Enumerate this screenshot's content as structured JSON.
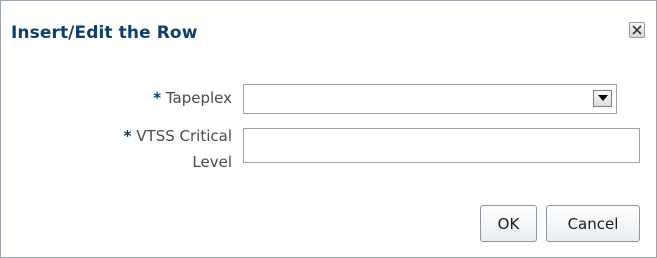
{
  "dialog": {
    "title": "Insert/Edit the Row",
    "close_icon": "close-icon"
  },
  "form": {
    "required_mark": "*",
    "tapeplex_label": "Tapeplex",
    "tapeplex_value": "",
    "dropdown_icon": "chevron-down-icon",
    "vtss_label_line1": "VTSS Critical",
    "vtss_label_line2": "Level",
    "vtss_value": ""
  },
  "buttons": {
    "ok_label": "OK",
    "cancel_label": "Cancel"
  },
  "colors": {
    "title": "#0b3f6f",
    "required": "#003c70",
    "label": "#4a4a4a",
    "border": "#9aa3ad"
  }
}
